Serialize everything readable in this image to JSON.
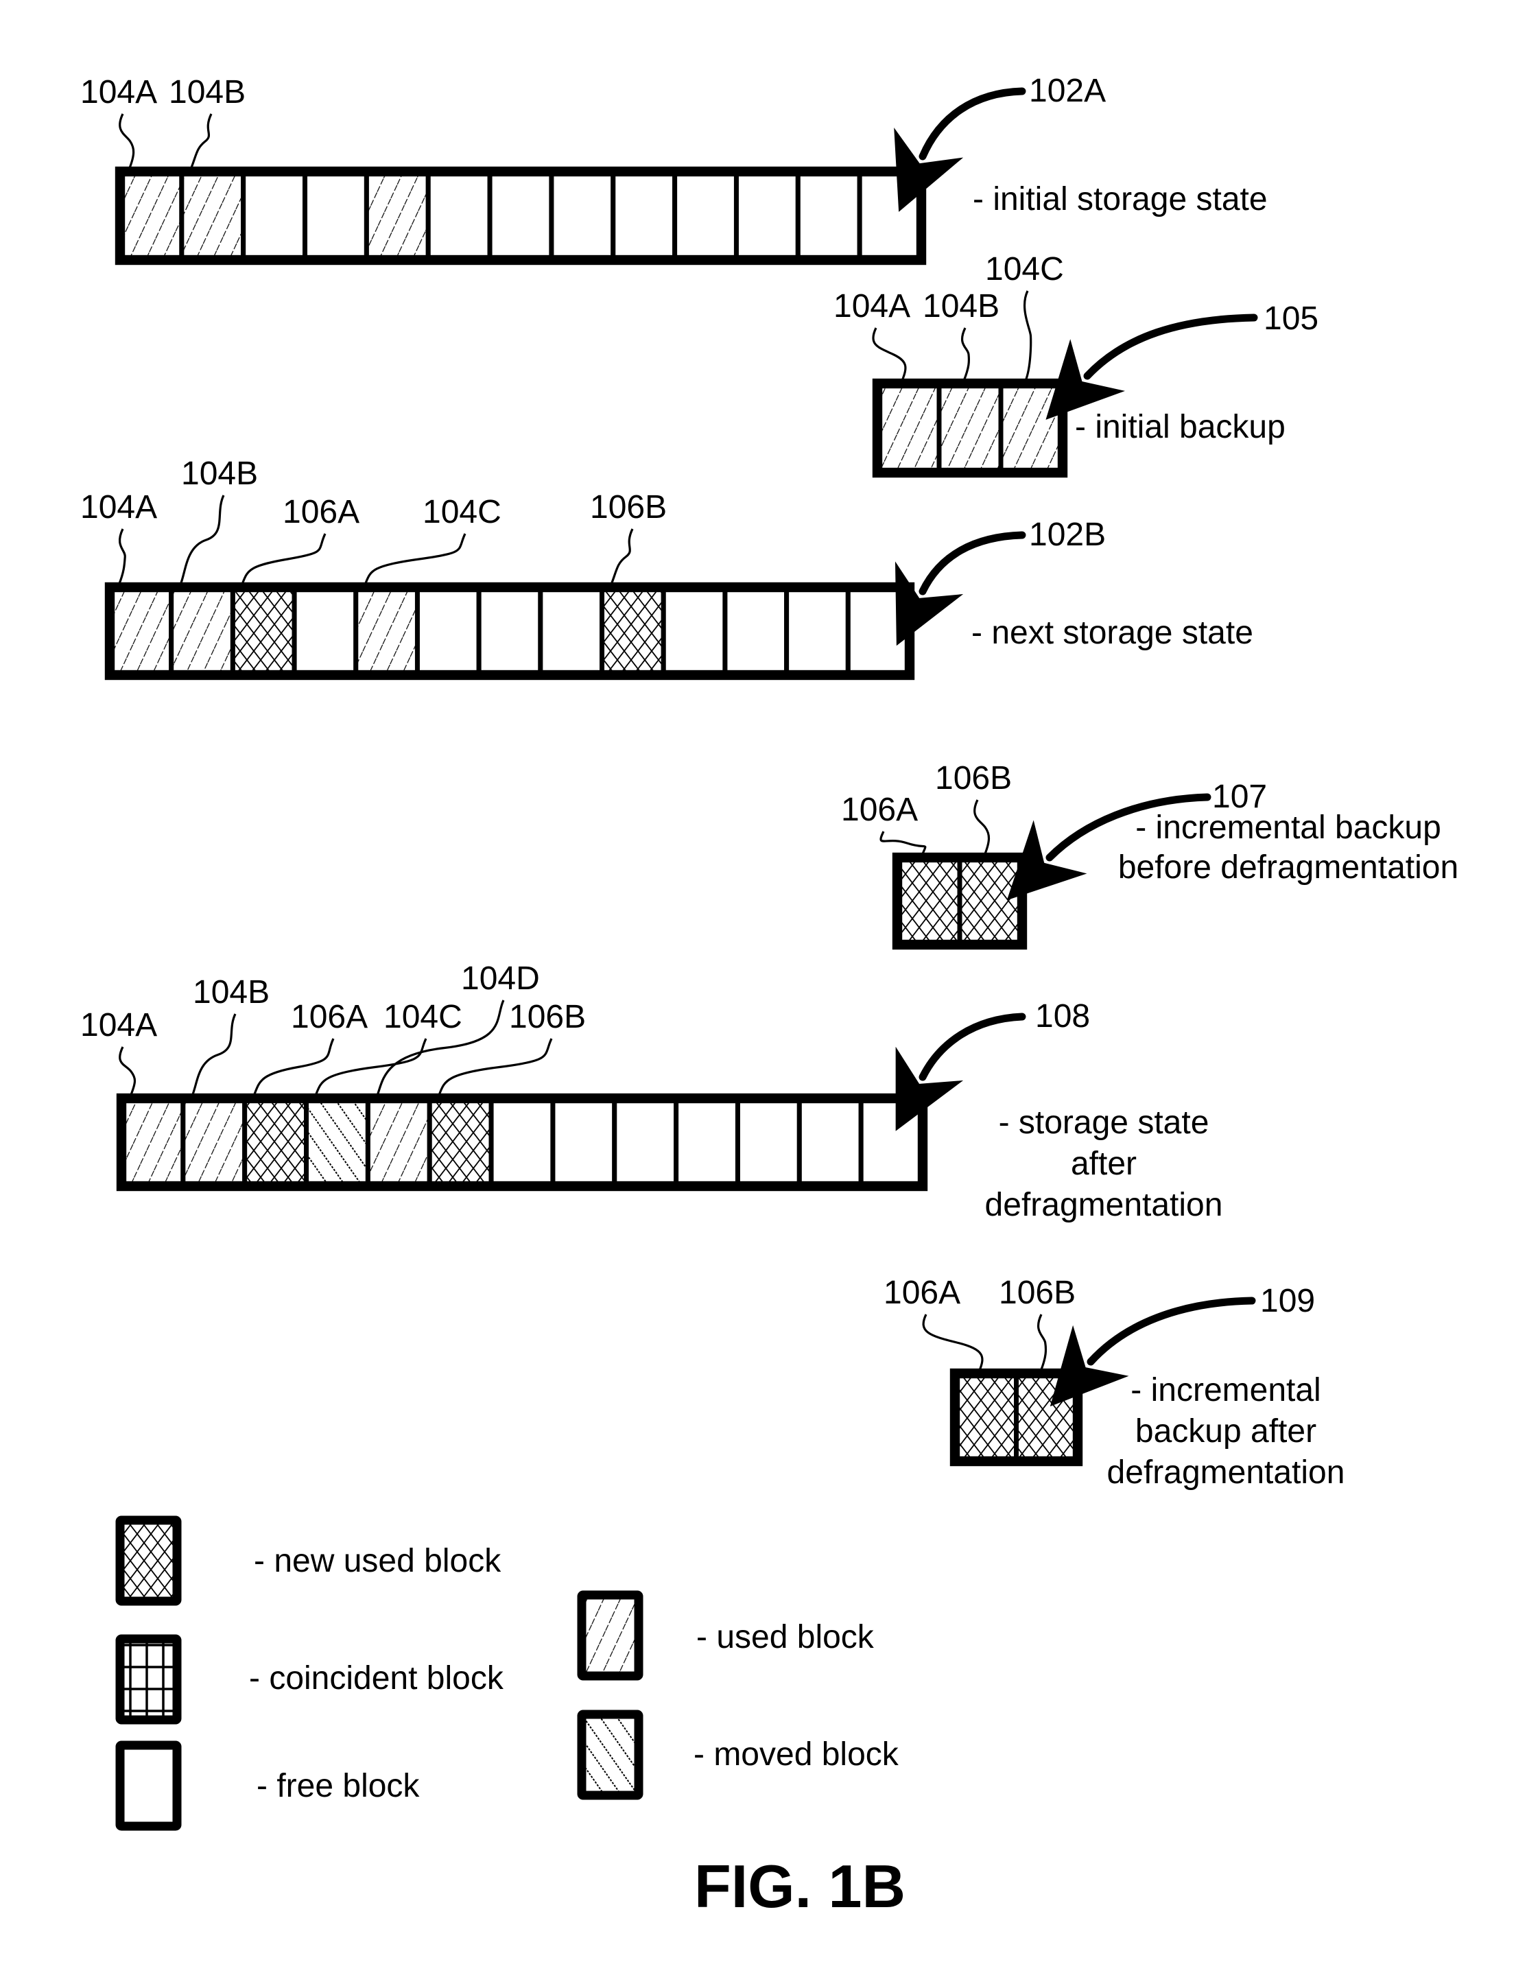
{
  "figure": {
    "title": "FIG. 1B",
    "colors": {
      "ink": "#000000",
      "paper": "#ffffff"
    }
  },
  "legend": [
    {
      "type": "new",
      "label": "- new used block"
    },
    {
      "type": "coincident",
      "label": "- coincident block"
    },
    {
      "type": "free",
      "label": "- free block"
    },
    {
      "type": "used",
      "label": "- used block"
    },
    {
      "type": "moved",
      "label": "- moved block"
    }
  ],
  "states": [
    {
      "ref": "102A",
      "description": [
        "- initial storage state"
      ],
      "cells": [
        "used",
        "used",
        "free",
        "free",
        "used",
        "free",
        "free",
        "free",
        "free",
        "free",
        "free",
        "free",
        "free"
      ],
      "callouts": [
        {
          "text": "104A",
          "cell": 0
        },
        {
          "text": "104B",
          "cell": 1
        }
      ]
    },
    {
      "ref": "105",
      "description": [
        "- initial backup"
      ],
      "cells": [
        "used",
        "used",
        "used"
      ],
      "callouts": [
        {
          "text": "104A",
          "cell": 0
        },
        {
          "text": "104B",
          "cell": 1
        },
        {
          "text": "104C",
          "cell": 2
        }
      ]
    },
    {
      "ref": "102B",
      "description": [
        "- next storage state"
      ],
      "cells": [
        "used",
        "used",
        "new",
        "free",
        "used",
        "free",
        "free",
        "free",
        "new",
        "free",
        "free",
        "free",
        "free"
      ],
      "callouts": [
        {
          "text": "104A",
          "cell": 0
        },
        {
          "text": "104B",
          "cell": 1
        },
        {
          "text": "106A",
          "cell": 2
        },
        {
          "text": "104C",
          "cell": 4
        },
        {
          "text": "106B",
          "cell": 8
        }
      ]
    },
    {
      "ref": "107",
      "description": [
        "- incremental backup",
        "before defragmentation"
      ],
      "cells": [
        "new",
        "new"
      ],
      "callouts": [
        {
          "text": "106A",
          "cell": 0
        },
        {
          "text": "106B",
          "cell": 1
        }
      ]
    },
    {
      "ref": "108",
      "description": [
        "- storage state",
        "after",
        "defragmentation"
      ],
      "cells": [
        "used",
        "used",
        "new",
        "moved",
        "used",
        "new",
        "free",
        "free",
        "free",
        "free",
        "free",
        "free",
        "free"
      ],
      "callouts": [
        {
          "text": "104A",
          "cell": 0
        },
        {
          "text": "104B",
          "cell": 1
        },
        {
          "text": "106A",
          "cell": 2
        },
        {
          "text": "104C",
          "cell": 3
        },
        {
          "text": "104D",
          "cell": 4
        },
        {
          "text": "106B",
          "cell": 5
        }
      ]
    },
    {
      "ref": "109",
      "description": [
        "- incremental",
        "backup after",
        "defragmentation"
      ],
      "cells": [
        "new",
        "new"
      ],
      "callouts": [
        {
          "text": "106A",
          "cell": 0
        },
        {
          "text": "106B",
          "cell": 1
        }
      ]
    }
  ]
}
